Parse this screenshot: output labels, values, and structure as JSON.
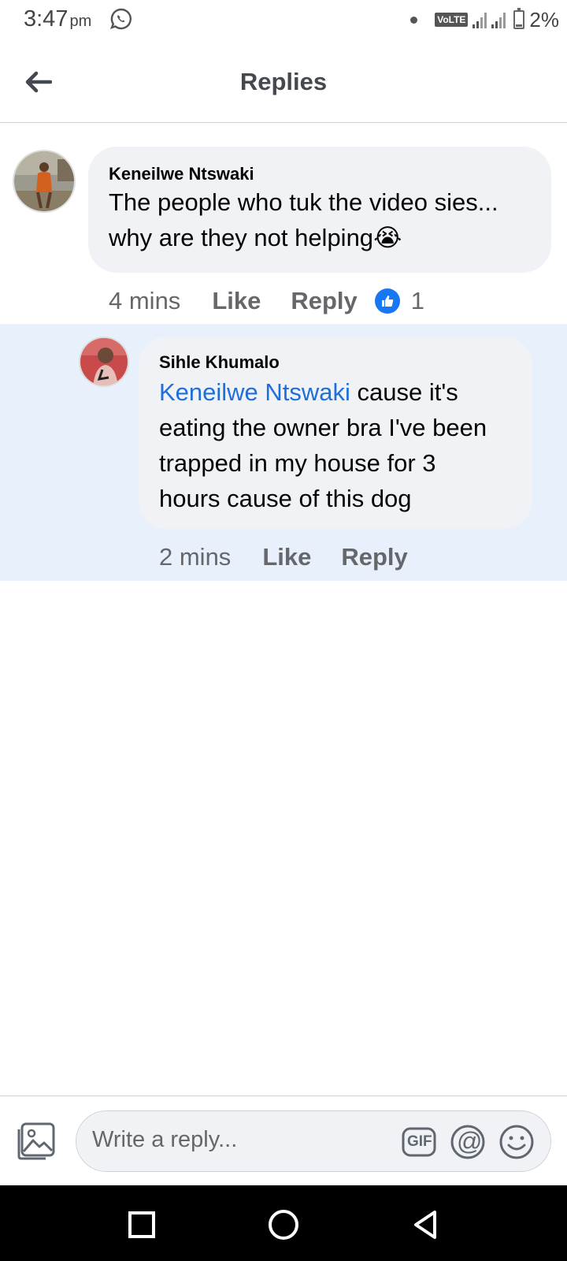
{
  "status_bar": {
    "time": "3:47",
    "ampm": "pm",
    "network_badge": "VoLTE",
    "battery": "2%",
    "icons": [
      "whatsapp-icon",
      "signal-icon",
      "battery-icon"
    ]
  },
  "header": {
    "title": "Replies",
    "back_icon": "back-arrow-icon"
  },
  "comment": {
    "author": "Keneilwe Ntswaki",
    "text_line1": "The people who tuk the video sies...",
    "text_line2": "why are they not helping",
    "emoji": "😭",
    "time": "4 mins",
    "like_label": "Like",
    "reply_label": "Reply",
    "like_count": "1"
  },
  "reply": {
    "author": "Sihle Khumalo",
    "mention": "Keneilwe Ntswaki",
    "text_line1_rest": " cause it's",
    "text_line2": "eating the owner bra I've been",
    "text_line3": "trapped in my house for 3",
    "text_line4": "hours cause of this dog",
    "time": "2 mins",
    "like_label": "Like",
    "reply_label": "Reply"
  },
  "composer": {
    "placeholder": "Write a reply...",
    "gif_label": "GIF",
    "mention_symbol": "@"
  },
  "colors": {
    "accent": "#1877f2",
    "mention": "#1e6fd9",
    "reply_highlight": "#e7f0fb",
    "bubble": "#f0f2f5"
  }
}
